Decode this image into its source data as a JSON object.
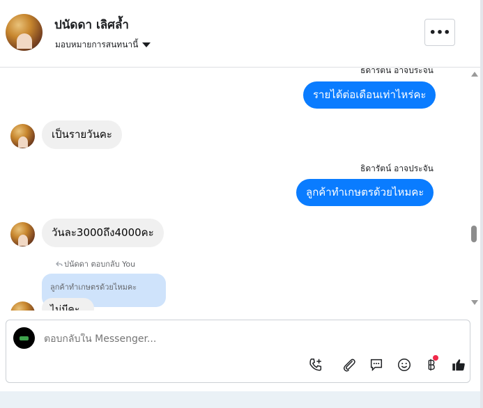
{
  "header": {
    "name": "ปนัดดา เลิศล้ำ",
    "subtitle": "มอบหมายการสนทนานี้",
    "more_label": "•••"
  },
  "messages": {
    "sender_top": "ธิดารัตน์ อาจประจัน",
    "out_1": "รายได้ต่อเดือนเท่าไหร่คะ",
    "in_1": "เป็นรายวันคะ",
    "sender_mid": "ธิดารัตน์ อาจประจัน",
    "out_2": "ลูกค้าทำเกษตรด้วยไหมคะ",
    "in_2": "วันละ3000ถึง4000คะ",
    "reply_meta": "ปนัดดา ตอบกลับ You",
    "reply_quote": "ลูกค้าทำเกษตรด้วยไหมคะ",
    "in_3_partial": "ไม่มีคะ"
  },
  "composer": {
    "placeholder": "ตอบกลับใน Messenger..."
  },
  "colors": {
    "outgoing": "#0a7cff",
    "incoming": "#f0f0f0",
    "quote": "#cfe3fb",
    "badge": "#f02849"
  },
  "icons": [
    "call-add-icon",
    "attachment-icon",
    "quick-reply-icon",
    "emoji-icon",
    "baht-icon",
    "like-icon"
  ]
}
